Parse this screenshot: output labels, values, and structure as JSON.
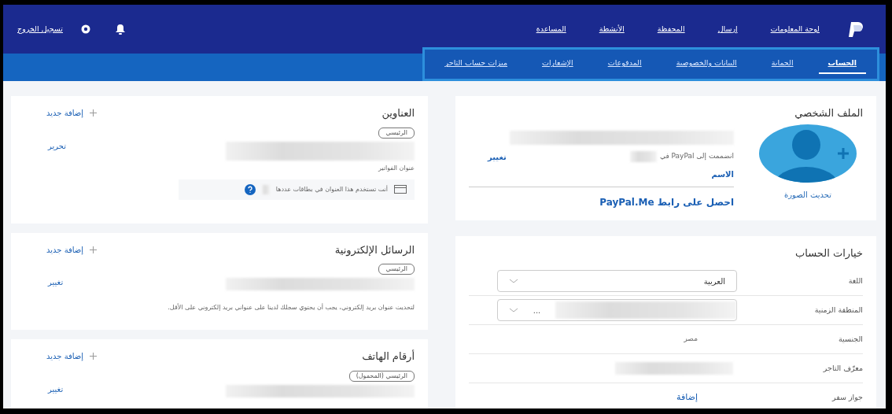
{
  "top_nav": {
    "items": [
      {
        "label": "لوحة المعلومات"
      },
      {
        "label": "إرسال"
      },
      {
        "label": "المحفظة"
      },
      {
        "label": "الأنشطة"
      },
      {
        "label": "المساعدة"
      }
    ],
    "logout": "تسجيل الخروج"
  },
  "sub_nav": {
    "tabs": [
      {
        "label": "الحساب",
        "selected": true
      },
      {
        "label": "الحماية",
        "selected": false
      },
      {
        "label": "البيانات والخصوصية",
        "selected": false
      },
      {
        "label": "المدفوعات",
        "selected": false
      },
      {
        "label": "الإشعارات",
        "selected": false
      },
      {
        "label": "ميزات حساب التاجر",
        "selected": false
      }
    ]
  },
  "profile": {
    "title": "الملف الشخصي",
    "photo_link": "تحديث الصورة",
    "joined": "انضممت إلى PayPal في",
    "name_link": "الاسم",
    "change_link": "تغيير",
    "paypal_me_link": "احصل على رابط PayPal.Me"
  },
  "account_options": {
    "title": "خيارات الحساب",
    "rows": [
      {
        "label": "اللغة",
        "kind": "select",
        "value": "العربية"
      },
      {
        "label": "المنطقة الزمنية",
        "kind": "select_masked",
        "value": "..."
      },
      {
        "label": "الجنسية",
        "kind": "text",
        "value": "مصر"
      },
      {
        "label": "معرّف التاجر",
        "kind": "masked"
      },
      {
        "label": "جواز سفر",
        "kind": "link",
        "value": "إضافة"
      }
    ]
  },
  "sections": [
    {
      "title": "العناوين",
      "add_link": "إضافة جديد",
      "badge": "الرئيسي",
      "edit_link": "تحرير",
      "caption": "عنوان الفواتير",
      "notice": "أنت تستخدم هذا العنوان في بطاقات عددها"
    },
    {
      "title": "الرسائل الإلكترونية",
      "add_link": "إضافة جديد",
      "badge": "الرئيسي",
      "edit_link": "تغيير",
      "note": "لتحديث عنوان بريد إلكتروني، يجب أن يحتوي سجلك لدينا على عنواني بريد إلكتروني على الأقل."
    },
    {
      "title": "أرقام الهاتف",
      "add_link": "إضافة جديد",
      "badge": "الرئيسي (المحمول)",
      "edit_link": "تغيير"
    }
  ]
}
